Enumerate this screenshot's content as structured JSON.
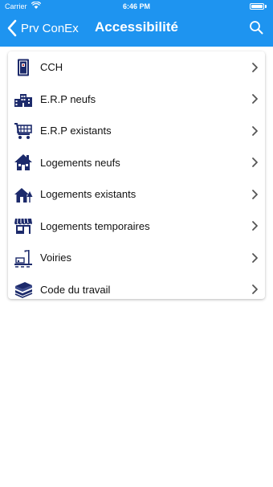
{
  "status_bar": {
    "carrier": "Carrier",
    "time": "6:46 PM"
  },
  "nav": {
    "back_label": "Prv ConEx",
    "title": "Accessibilité"
  },
  "colors": {
    "header_bg": "#1e94f0",
    "icon_navy": "#1c2a6b",
    "chevron": "#555555"
  },
  "list": {
    "items": [
      {
        "label": "CCH",
        "icon": "book-icon"
      },
      {
        "label": "E.R.P neufs",
        "icon": "buildings-icon"
      },
      {
        "label": "E.R.P existants",
        "icon": "shopping-cart-icon"
      },
      {
        "label": "Logements neufs",
        "icon": "house-icon"
      },
      {
        "label": "Logements existants",
        "icon": "house-tree-icon"
      },
      {
        "label": "Logements temporaires",
        "icon": "shop-awning-icon"
      },
      {
        "label": "Voiries",
        "icon": "street-icon"
      },
      {
        "label": "Code du travail",
        "icon": "stacked-papers-icon"
      }
    ]
  }
}
